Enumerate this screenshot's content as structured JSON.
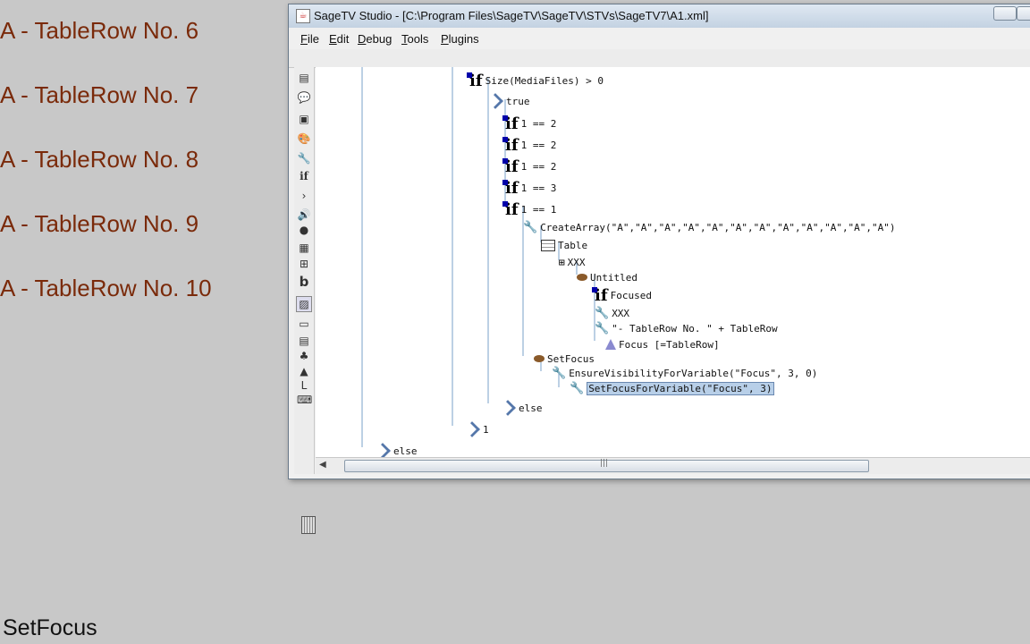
{
  "background": {
    "rows": [
      "A  - TableRow No. 6",
      "A  - TableRow No. 7",
      "A  - TableRow No. 8",
      "A  - TableRow No. 9",
      "A  - TableRow No. 10"
    ],
    "status": "SetFocus"
  },
  "window": {
    "title": "SageTV Studio - [C:\\Program Files\\SageTV\\SageTV\\STVs\\SageTV7\\A1.xml]",
    "app_icon": "java-cup-icon"
  },
  "menu": [
    "File",
    "Edit",
    "Debug",
    "Tools",
    "Plugins"
  ],
  "palette_icons": [
    "menu-icon",
    "option-panel-icon",
    "panel-icon",
    "theme-icon",
    "action-icon",
    "conditional-icon",
    "branch-icon",
    "sound-icon",
    "listener-icon",
    "table-icon",
    "table-component-icon",
    "text-icon",
    "image-icon",
    "text-input-icon",
    "video-icon",
    "effect-icon",
    "attribute-icon",
    "hook-icon",
    "shortcut-icon"
  ],
  "tree": {
    "n0": "Size(MediaFiles) > 0",
    "n1": "true",
    "n2": "1 == 2",
    "n3": "1 == 2",
    "n4": "1 == 2",
    "n5": "1 == 3",
    "n6": "1 == 1",
    "n7": "CreateArray(\"A\",\"A\",\"A\",\"A\",\"A\",\"A\",\"A\",\"A\",\"A\",\"A\",\"A\",\"A\")",
    "n8": "Table",
    "n9": "XXX",
    "n10": "Untitled",
    "n11": "Focused",
    "n12": "XXX",
    "n13": "\"- TableRow No. \" + TableRow",
    "n14": "Focus [=TableRow]",
    "n15": "SetFocus",
    "n16": "EnsureVisibilityForVariable(\"Focus\", 3, 0)",
    "n17": "SetFocusForVariable(\"Focus\", 3)",
    "n18": "else",
    "n19": "1",
    "n20": "else"
  },
  "selected_node": "n17",
  "colors": {
    "background_text": "#7a2a0a",
    "selection": "#b8cfe8"
  }
}
